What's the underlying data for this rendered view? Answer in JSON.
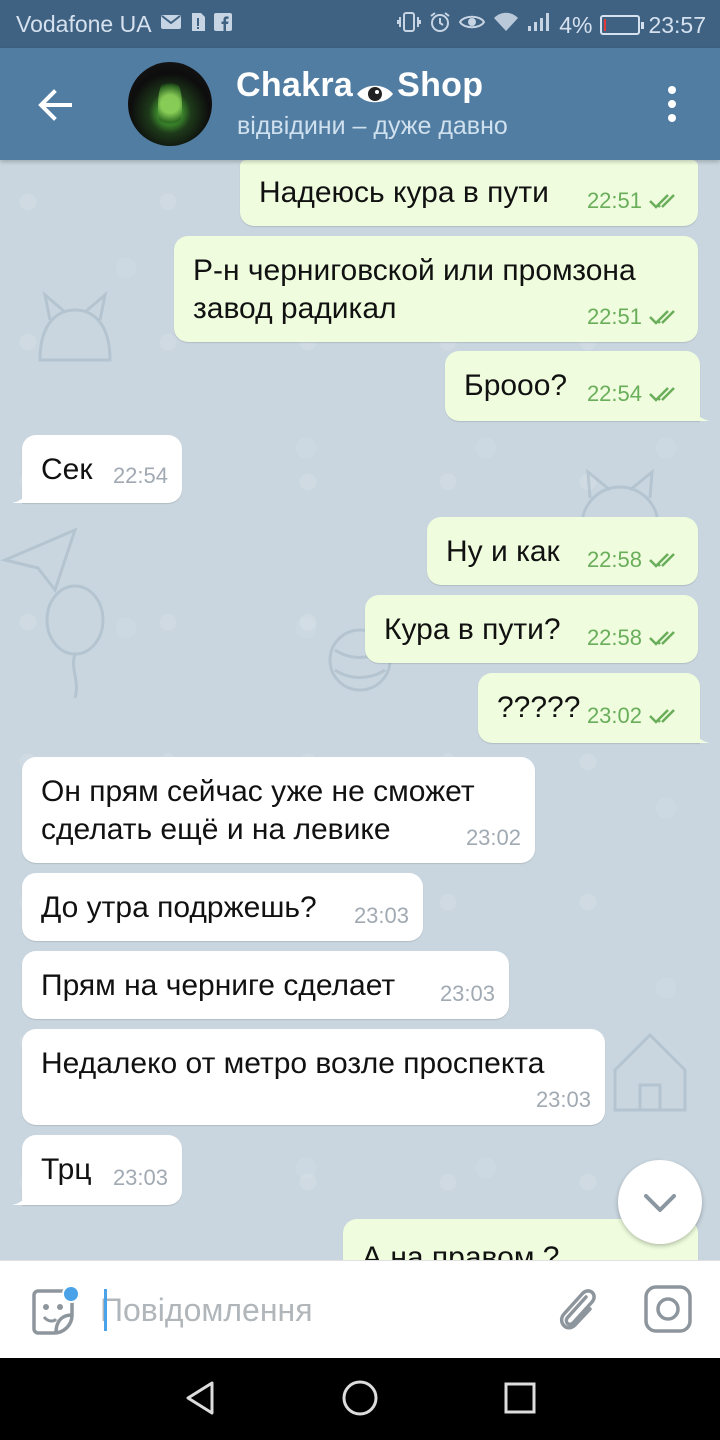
{
  "status_bar": {
    "carrier": "Vodafone UA",
    "battery_percent": "4%",
    "time": "23:57",
    "battery_level": 0.04,
    "icons": [
      "mail-icon",
      "sim-icon",
      "facebook-icon",
      "vibrate-icon",
      "alarm-icon",
      "eye-icon",
      "wifi-icon",
      "signal-icon",
      "battery-icon"
    ]
  },
  "header": {
    "title_part1": "Chakra",
    "title_part2": "Shop",
    "title_icon": "eye-icon",
    "subtitle": "відвідини – дуже давно"
  },
  "messages": [
    {
      "direction": "out",
      "text": "Надеюсь кура в пути",
      "time": "22:51",
      "read": true
    },
    {
      "direction": "out",
      "text": "Р-н черниговской или промзона завод радикал",
      "time": "22:51",
      "read": true
    },
    {
      "direction": "out",
      "text": "Брооо?",
      "time": "22:54",
      "read": true
    },
    {
      "direction": "in",
      "text": "Сек",
      "time": "22:54"
    },
    {
      "direction": "out",
      "text": "Ну и как",
      "time": "22:58",
      "read": true
    },
    {
      "direction": "out",
      "text": "Кура в пути?",
      "time": "22:58",
      "read": true
    },
    {
      "direction": "out",
      "text": "?????",
      "time": "23:02",
      "read": true
    },
    {
      "direction": "in",
      "text": "Он прям сейчас уже не сможет сделать ещё и на левике",
      "time": "23:02"
    },
    {
      "direction": "in",
      "text": "До утра подржешь?",
      "time": "23:03"
    },
    {
      "direction": "in",
      "text": "Прям на черниге сделает",
      "time": "23:03"
    },
    {
      "direction": "in",
      "text": "Недалеко от метро возле проспекта",
      "time": "23:03"
    },
    {
      "direction": "in",
      "text": "Трц",
      "time": "23:03"
    },
    {
      "direction": "out",
      "text": "А на правом ?",
      "time": "",
      "partial": true
    }
  ],
  "input": {
    "placeholder": "Повідомлення",
    "value": ""
  },
  "colors": {
    "status_bar": "#3f6182",
    "header": "#517da2",
    "outgoing_bubble": "#effdde",
    "incoming_bubble": "#ffffff",
    "check_marks": "#6aae5b",
    "accent": "#4aa3e8"
  }
}
